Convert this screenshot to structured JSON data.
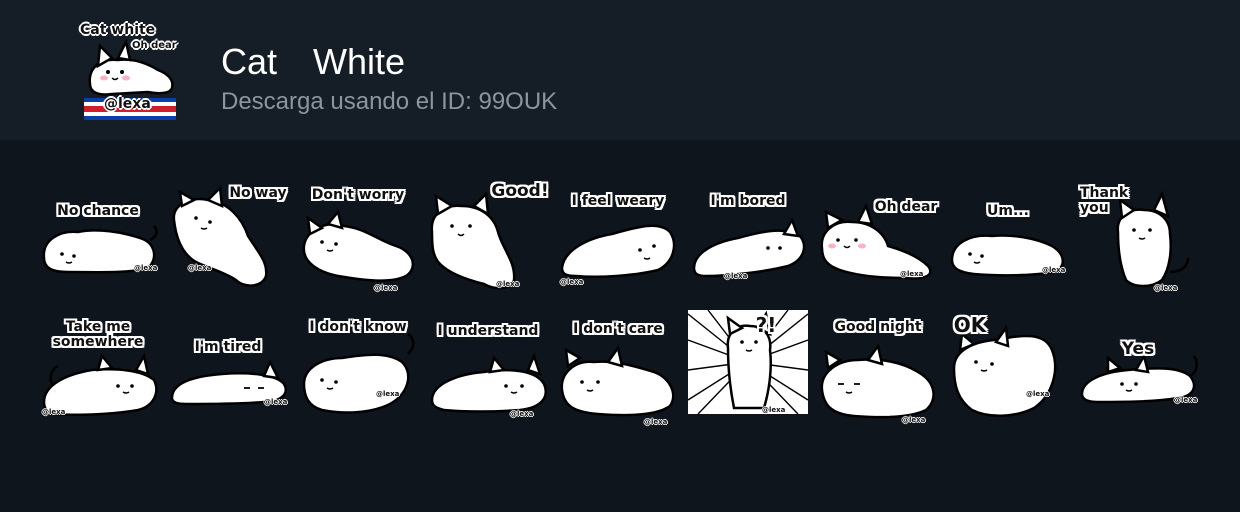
{
  "pack": {
    "title": "Cat　White",
    "subtitle": "Descarga usando el ID: 99OUK",
    "icon": {
      "name": "pack-icon-cat",
      "title_text": "Cat white",
      "caption_text": "Oh dear",
      "watermark_text": "@lexa"
    }
  },
  "watermark": "@lexa",
  "stickers": [
    {
      "caption": "No chance"
    },
    {
      "caption": "No way"
    },
    {
      "caption": "Don't worry"
    },
    {
      "caption": "Good!"
    },
    {
      "caption": "I feel weary"
    },
    {
      "caption": "I'm bored"
    },
    {
      "caption": "Oh dear"
    },
    {
      "caption": "Um..."
    },
    {
      "caption": "Thank\nyou"
    },
    {
      "caption": "Take me\nsomewhere"
    },
    {
      "caption": "I'm tired"
    },
    {
      "caption": "I don't know"
    },
    {
      "caption": "I understand"
    },
    {
      "caption": "I don't care"
    },
    {
      "caption": "?!"
    },
    {
      "caption": "Good night"
    },
    {
      "caption": "OK"
    },
    {
      "caption": "Yes"
    }
  ]
}
